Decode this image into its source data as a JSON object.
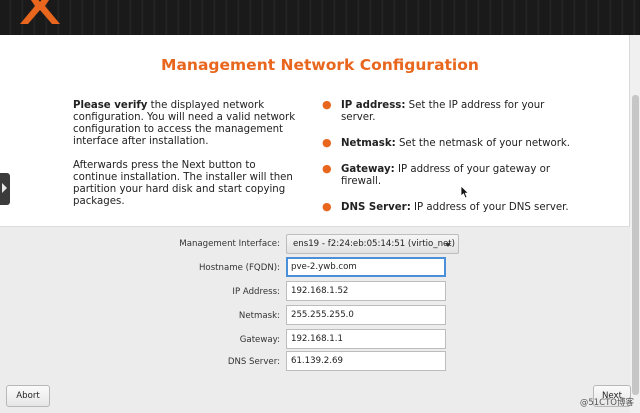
{
  "header": {
    "title": "Management Network Configuration"
  },
  "intro": {
    "verify_bold": "Please verify",
    "verify_rest": " the displayed network configuration. You will need a valid network configuration to access the management interface after installation.",
    "afterwards": "Afterwards press the Next button to continue installation. The installer will then partition your hard disk and start copying packages."
  },
  "bullets": [
    {
      "term": "IP address:",
      "desc": " Set the IP address for your server."
    },
    {
      "term": "Netmask:",
      "desc": " Set the netmask of your network."
    },
    {
      "term": "Gateway:",
      "desc": " IP address of your gateway or firewall."
    },
    {
      "term": "DNS Server:",
      "desc": " IP address of your DNS server."
    }
  ],
  "form": {
    "interface_label": "Management Interface:",
    "interface_value": "ens19 - f2:24:eb:05:14:51 (virtio_net)",
    "hostname_label": "Hostname (FQDN):",
    "hostname_value": "pve-2.ywb.com",
    "ip_label": "IP Address:",
    "ip_value": "192.168.1.52",
    "netmask_label": "Netmask:",
    "netmask_value": "255.255.255.0",
    "gateway_label": "Gateway:",
    "gateway_value": "192.168.1.1",
    "dns_label": "DNS Server:",
    "dns_value": "61.139.2.69"
  },
  "buttons": {
    "abort": "Abort",
    "next": "Next"
  },
  "watermark": "@51CTO博客",
  "colors": {
    "accent": "#e8661d",
    "focus": "#4a90d9"
  }
}
